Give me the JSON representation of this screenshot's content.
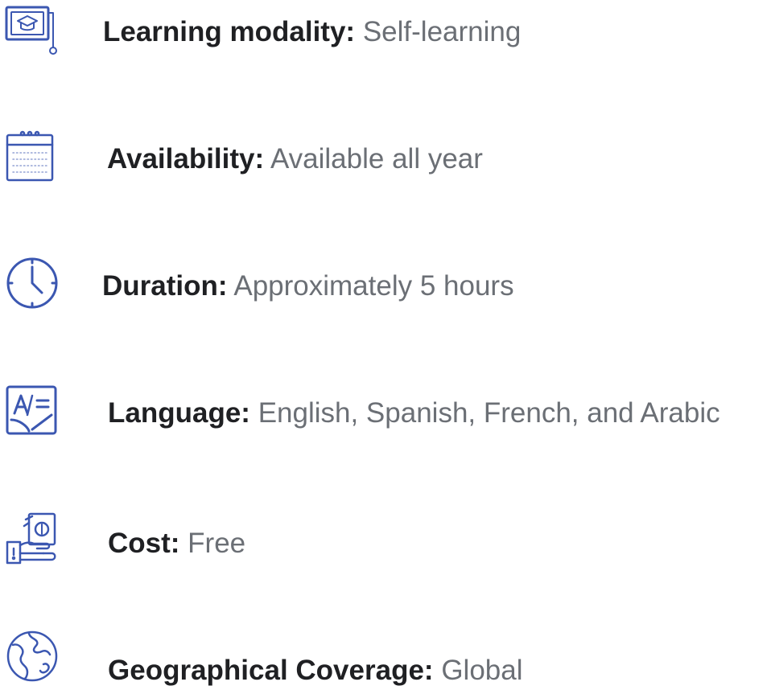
{
  "info_list": {
    "accent_color": "#3b57b1",
    "items": [
      {
        "icon": "graduation-screen-icon",
        "label": "Learning modality:",
        "value": "Self-learning"
      },
      {
        "icon": "calendar-icon",
        "label": "Availability:",
        "value": "Available all year"
      },
      {
        "icon": "clock-icon",
        "label": "Duration:",
        "value": "Approximately 5 hours"
      },
      {
        "icon": "translation-icon",
        "label": "Language:",
        "value": "English, Spanish, French, and Arabic"
      },
      {
        "icon": "money-hand-icon",
        "label": "Cost:",
        "value": "Free"
      },
      {
        "icon": "globe-icon",
        "label": "Geographical Coverage:",
        "value": "Global"
      }
    ]
  }
}
